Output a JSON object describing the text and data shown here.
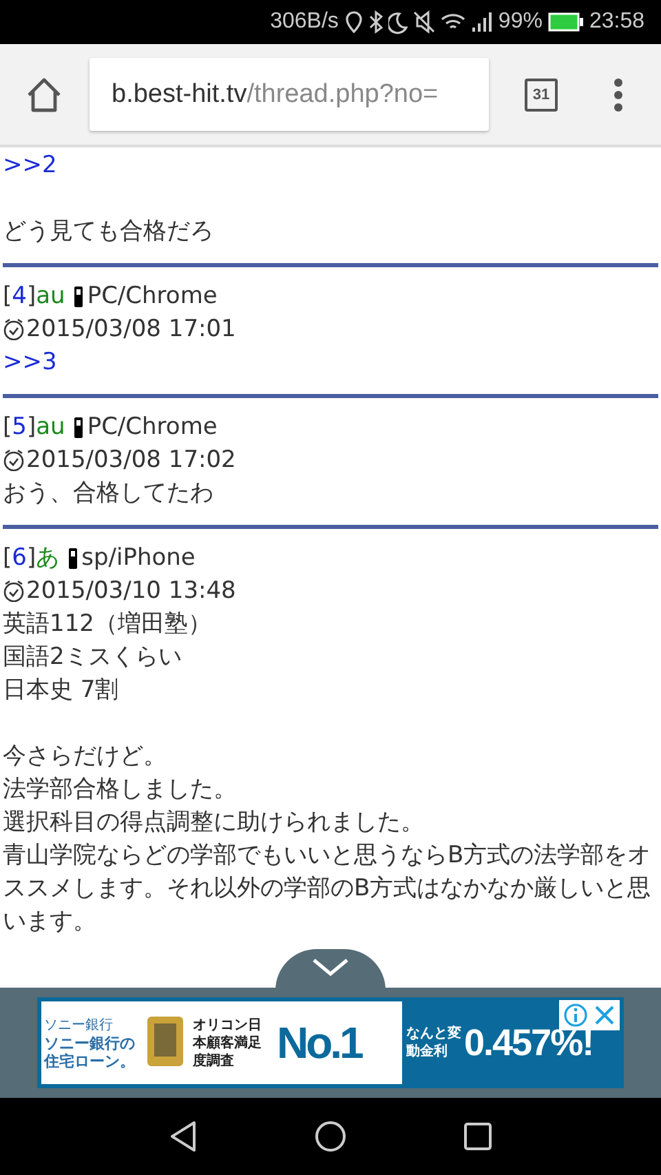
{
  "status_bar": {
    "speed": "306B/s",
    "battery_percent": "99%",
    "time": "23:58"
  },
  "toolbar": {
    "url_host": "b.best-hit.tv",
    "url_path": "/thread.php?no=",
    "tab_count": "31"
  },
  "posts": [
    {
      "paragraphs": [
        [
          {
            "kind": "reply",
            "text": ">>2"
          }
        ],
        [
          {
            "kind": "text",
            "text": "どう見ても合格だろ"
          }
        ]
      ]
    },
    {
      "number": {
        "open": "[",
        "value": "4",
        "close": "]"
      },
      "carrier": "au",
      "device": "PC/Chrome",
      "date": "2015/03/08 17:01",
      "paragraphs": [
        [
          {
            "kind": "reply",
            "text": ">>3"
          }
        ]
      ]
    },
    {
      "number": {
        "open": "[",
        "value": "5",
        "close": "]"
      },
      "carrier": "au",
      "device": "PC/Chrome",
      "date": "2015/03/08 17:02",
      "paragraphs": [
        [
          {
            "kind": "text",
            "text": "おう、合格してたわ"
          }
        ]
      ]
    },
    {
      "number": {
        "open": "[",
        "value": "6",
        "close": "]"
      },
      "carrier": "あ",
      "device": "sp/iPhone",
      "date": "2015/03/10 13:48",
      "paragraphs": [
        [
          {
            "kind": "text",
            "text": "英語112（増田塾）"
          },
          {
            "kind": "text",
            "text": "国語2ミスくらい"
          },
          {
            "kind": "text",
            "text": "日本史 7割"
          }
        ],
        [
          {
            "kind": "text",
            "text": "今さらだけど。"
          },
          {
            "kind": "text",
            "text": "法学部合格しました。"
          },
          {
            "kind": "text",
            "text": "選択科目の得点調整に助けられました。"
          },
          {
            "kind": "text",
            "text": "青山学院ならどの学部でもいいと思うならB方式の法学部をオススメします。それ以外の学部のB方式はなかなか厳しいと思います。"
          }
        ]
      ]
    }
  ],
  "ad": {
    "brand": "ソニー銀行",
    "headline": "ソニー銀行の住宅ローン。",
    "survey": "オリコン日本顧客満足度調査",
    "rank": "No.1",
    "rate_label": "なんと変動金利",
    "rate": "0.457%!"
  }
}
